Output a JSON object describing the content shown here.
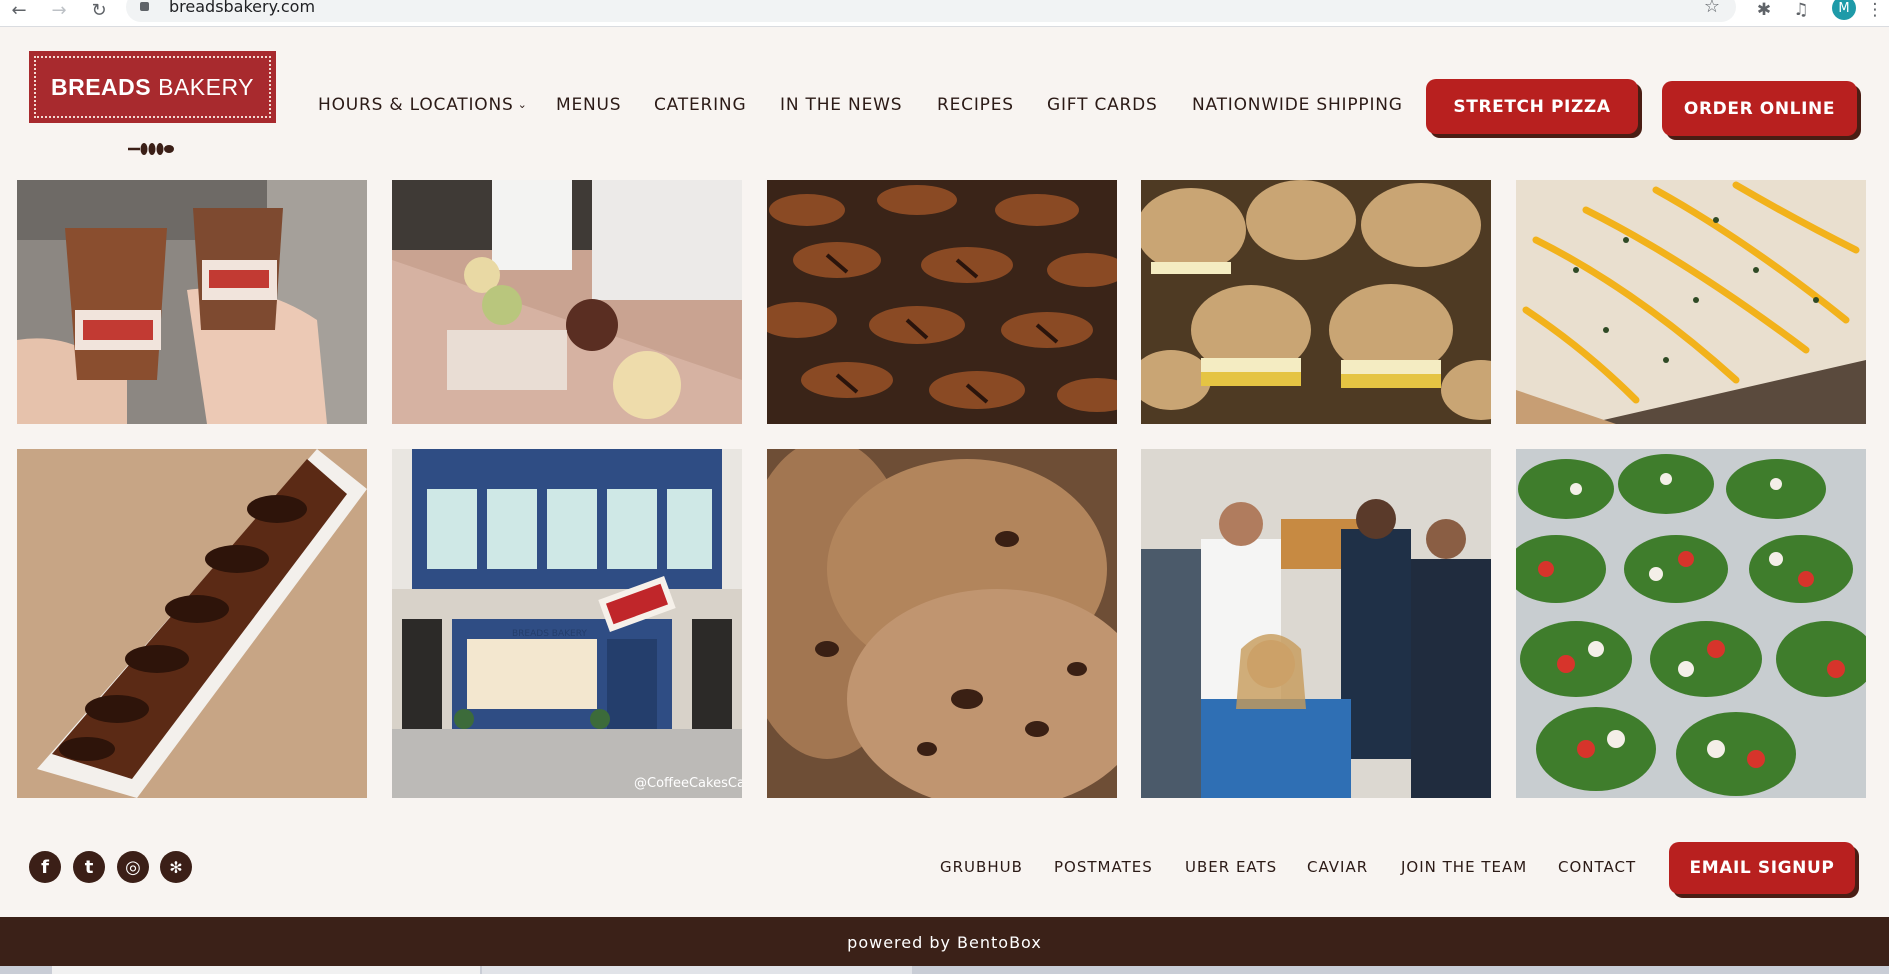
{
  "browser": {
    "url": "breadsbakery.com",
    "profile_initial": "M"
  },
  "header": {
    "logo_bold": "BREADS",
    "logo_regular": "BAKERY",
    "nav": [
      {
        "label": "HOURS & LOCATIONS",
        "has_dropdown": true
      },
      {
        "label": "MENUS"
      },
      {
        "label": "CATERING"
      },
      {
        "label": "IN THE NEWS"
      },
      {
        "label": "RECIPES"
      },
      {
        "label": "GIFT CARDS"
      },
      {
        "label": "NATIONWIDE SHIPPING"
      }
    ],
    "stretch_pizza_label": "STRETCH PIZZA",
    "order_online_label": "ORDER ONLINE"
  },
  "gallery": [
    {
      "name": "iced-coffee-cups-photo",
      "alt": "Two iced coffees"
    },
    {
      "name": "pizza-making-photo",
      "alt": "Chefs stretching pizza"
    },
    {
      "name": "rugelach-photo",
      "alt": "Chocolate rugelach"
    },
    {
      "name": "sandwiches-photo",
      "alt": "Sesame sandwiches"
    },
    {
      "name": "pizza-closeup-photo",
      "alt": "Pizza with sauce drizzle"
    },
    {
      "name": "babka-photo",
      "alt": "Chocolate babka"
    },
    {
      "name": "storefront-illustration",
      "alt": "Bakery storefront illustration",
      "caption": "@CoffeeCakesCafe",
      "sign_text": "BREADS BAKERY"
    },
    {
      "name": "cookies-photo",
      "alt": "Chocolate chip cookies"
    },
    {
      "name": "medical-staff-photo",
      "alt": "Medical staff with treats"
    },
    {
      "name": "salads-photo",
      "alt": "Packaged salads"
    }
  ],
  "footer": {
    "social": [
      {
        "name": "facebook-icon",
        "glyph": "f"
      },
      {
        "name": "twitter-icon",
        "glyph": "t"
      },
      {
        "name": "instagram-icon",
        "glyph": "◎"
      },
      {
        "name": "yelp-icon",
        "glyph": "✻"
      }
    ],
    "links": [
      "GRUBHUB",
      "POSTMATES",
      "UBER EATS",
      "CAVIAR",
      "JOIN THE TEAM",
      "CONTACT"
    ],
    "email_signup_label": "EMAIL SIGNUP",
    "powered_by": "powered by BentoBox"
  },
  "colors": {
    "brand_red": "#b8201f",
    "logo_red": "#a82a2e",
    "dark_brown": "#3b2118",
    "page_bg": "#f8f4f1"
  }
}
